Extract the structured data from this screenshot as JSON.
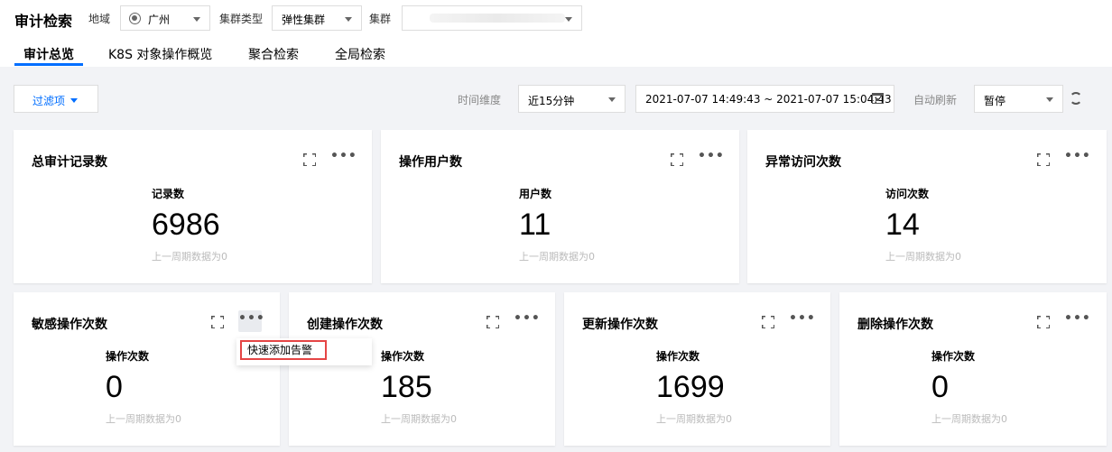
{
  "header": {
    "title": "审计检索",
    "region_label": "地域",
    "region_value": "广州",
    "cluster_type_label": "集群类型",
    "cluster_type_value": "弹性集群",
    "cluster_label": "集群",
    "cluster_value": ""
  },
  "tabs": [
    {
      "label": "审计总览",
      "active": true
    },
    {
      "label": "K8S 对象操作概览",
      "active": false
    },
    {
      "label": "聚合检索",
      "active": false
    },
    {
      "label": "全局检索",
      "active": false
    }
  ],
  "toolbar": {
    "filter_label": "过滤项",
    "time_dim_label": "时间维度",
    "time_dim_value": "近15分钟",
    "date_range": "2021-07-07 14:49:43 ~ 2021-07-07 15:04:43",
    "auto_refresh_label": "自动刷新",
    "auto_refresh_value": "暂停"
  },
  "cards_row1": [
    {
      "title": "总审计记录数",
      "metric_label": "记录数",
      "value": "6986",
      "sub": "上一周期数据为0"
    },
    {
      "title": "操作用户数",
      "metric_label": "用户数",
      "value": "11",
      "sub": "上一周期数据为0"
    },
    {
      "title": "异常访问次数",
      "metric_label": "访问次数",
      "value": "14",
      "sub": "上一周期数据为0"
    }
  ],
  "cards_row2": [
    {
      "title": "敏感操作次数",
      "metric_label": "操作次数",
      "value": "0",
      "sub": "上一周期数据为0"
    },
    {
      "title": "创建操作次数",
      "metric_label": "操作次数",
      "value": "185",
      "sub": "上一周期数据为0"
    },
    {
      "title": "更新操作次数",
      "metric_label": "操作次数",
      "value": "1699",
      "sub": "上一周期数据为0"
    },
    {
      "title": "删除操作次数",
      "metric_label": "操作次数",
      "value": "0",
      "sub": "上一周期数据为0"
    }
  ],
  "popup": {
    "item_label": "快速添加告警"
  },
  "icons": {
    "more": "ellipsis-icon",
    "expand": "fullscreen-icon",
    "calendar": "calendar-icon",
    "refresh": "refresh-icon",
    "globe": "globe-icon"
  },
  "colors": {
    "accent": "#006eff",
    "highlight_border": "#e54545",
    "background": "#f2f3f6"
  }
}
